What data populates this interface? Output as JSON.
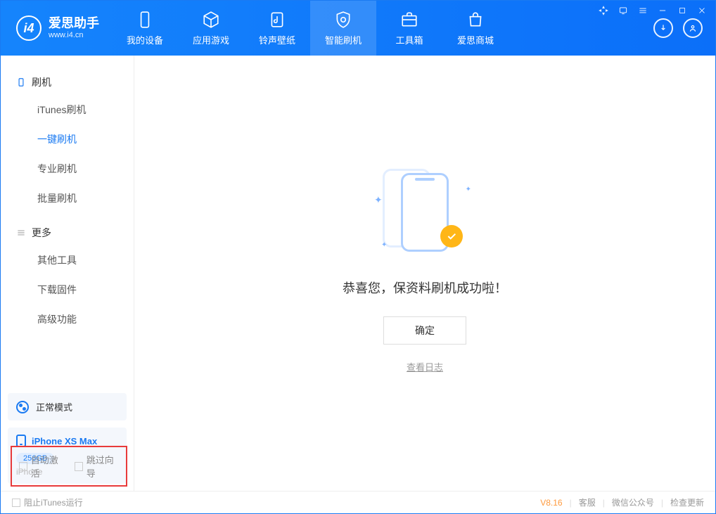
{
  "app": {
    "title": "爱思助手",
    "subtitle": "www.i4.cn"
  },
  "tabs": {
    "device": "我的设备",
    "apps": "应用游戏",
    "ringtones": "铃声壁纸",
    "flash": "智能刷机",
    "toolbox": "工具箱",
    "store": "爱思商城"
  },
  "sidebar": {
    "flash_head": "刷机",
    "items": {
      "itunes": "iTunes刷机",
      "oneclick": "一键刷机",
      "pro": "专业刷机",
      "batch": "批量刷机"
    },
    "more_head": "更多",
    "more": {
      "other": "其他工具",
      "firmware": "下载固件",
      "advanced": "高级功能"
    }
  },
  "device": {
    "mode": "正常模式",
    "name": "iPhone XS Max",
    "storage": "256GB",
    "type": "iPhone"
  },
  "main": {
    "success": "恭喜您，保资料刷机成功啦！",
    "ok": "确定",
    "log": "查看日志"
  },
  "options": {
    "auto_activate": "自动激活",
    "skip_guide": "跳过向导"
  },
  "footer": {
    "block_itunes": "阻止iTunes运行",
    "version": "V8.16",
    "service": "客服",
    "wechat": "微信公众号",
    "update": "检查更新"
  }
}
